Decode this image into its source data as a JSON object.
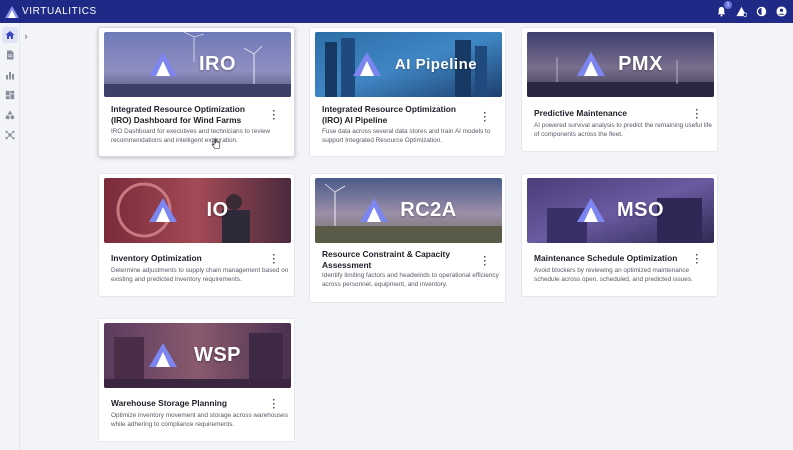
{
  "app": {
    "brand": "VIRTUALITICS"
  },
  "topbar": {
    "notification_count": "1"
  },
  "cards": [
    {
      "abbr": "IRO",
      "title": "Integrated Resource Optimization (IRO) Dashboard for Wind Farms",
      "description": "IRO Dashboard for executives and technicians to review recommendations and intelligent exploration."
    },
    {
      "abbr": "AI Pipeline",
      "title": "Integrated Resource Optimization (IRO) AI Pipeline",
      "description": "Fuse data across several data stores and train AI models to support Integrated Resource Optimization."
    },
    {
      "abbr": "PMX",
      "title": "Predictive Maintenance",
      "description": "AI powered survival analysis to predict the remaining useful life of components across the fleet."
    },
    {
      "abbr": "IO",
      "title": "Inventory Optimization",
      "description": "Determine adjustments to supply chain management based on existing and predicted inventory requirements."
    },
    {
      "abbr": "RC2A",
      "title": "Resource Constraint & Capacity Assessment",
      "description": "Identify limiting factors and headwinds to operational efficiency across personnel, equipment, and inventory."
    },
    {
      "abbr": "MSO",
      "title": "Maintenance Schedule Optimization",
      "description": "Avoid blockers by reviewing an optimized maintenance schedule across open, scheduled, and predicted issues."
    },
    {
      "abbr": "WSP",
      "title": "Warehouse Storage Planning",
      "description": "Optimize inventory movement and storage across warehouses while adhering to compliance requirements."
    }
  ],
  "colors": {
    "topbar": "#1f2a86",
    "accent": "#6b74e0",
    "background": "#f3f4f8"
  }
}
